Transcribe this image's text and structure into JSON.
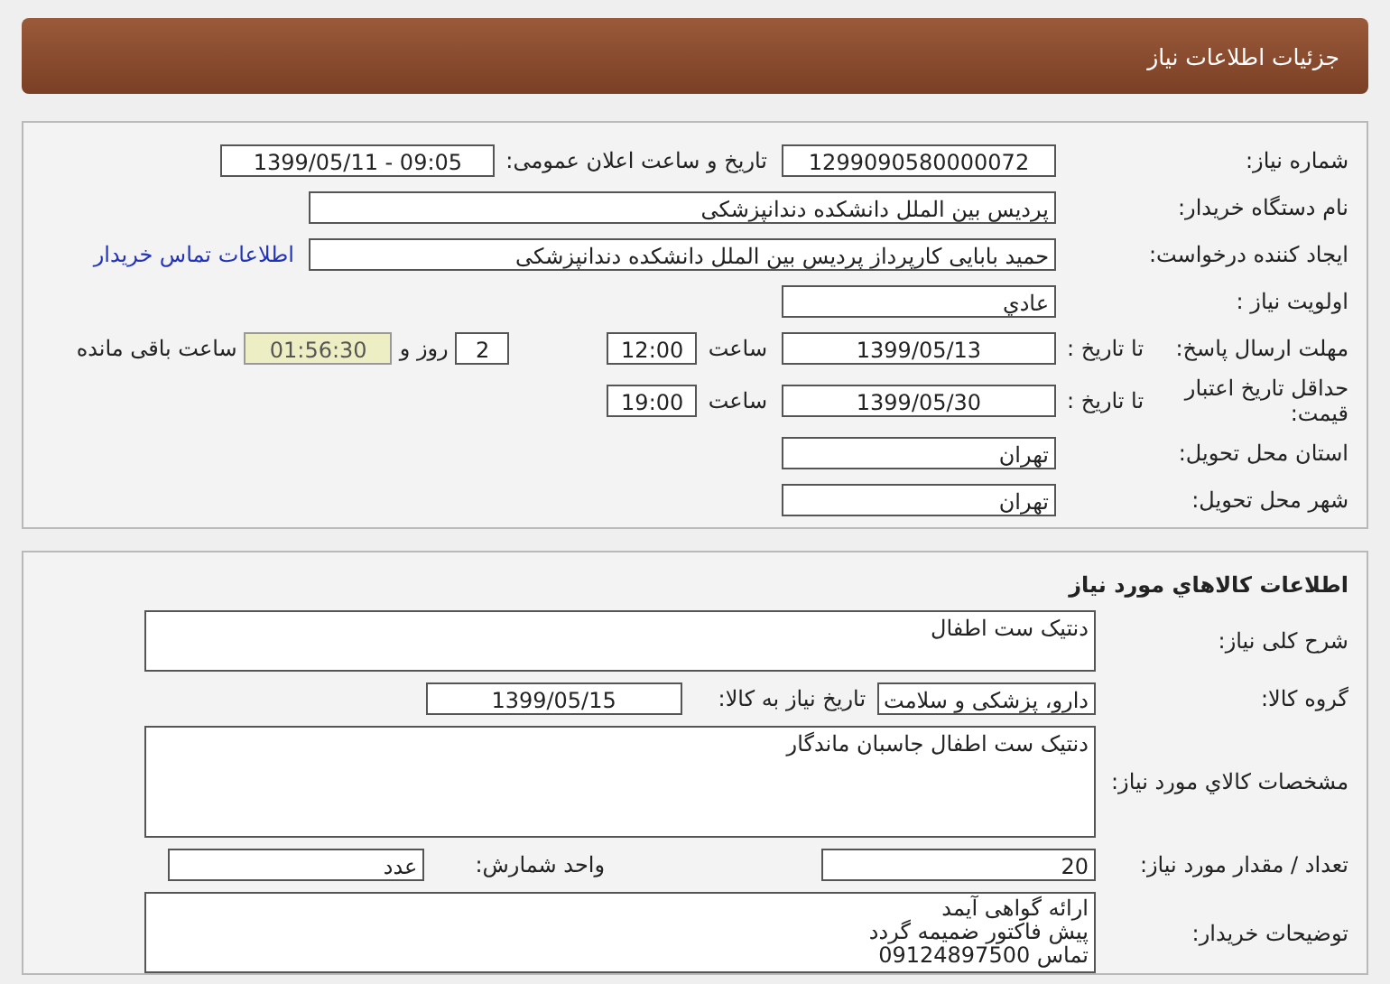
{
  "header": {
    "title": "جزئیات اطلاعات نیاز"
  },
  "tender": {
    "number_label": "شماره نیاز:",
    "number": "1299090580000072",
    "announce_label": "تاریخ و ساعت اعلان عمومی:",
    "announce": "1399/05/11 - 09:05",
    "buyer_label": "نام دستگاه خریدار:",
    "buyer": "پردیس بین الملل دانشکده دندانپزشکی",
    "creator_label": "ایجاد کننده درخواست:",
    "creator": "حمید بابایی کارپرداز پردیس بین الملل دانشکده دندانپزشکی",
    "contact_link": "اطلاعات تماس خریدار",
    "priority_label": "اولویت نیاز :",
    "priority": "عادي",
    "deadline_label": "مهلت ارسال پاسخ:",
    "deadline_to": "تا تاریخ :",
    "deadline_date": "1399/05/13",
    "deadline_time_label": "ساعت",
    "deadline_time": "12:00",
    "days": "2",
    "days_label": "روز و",
    "remaining": "01:56:30",
    "remaining_label": "ساعت باقی مانده",
    "validity_label": "حداقل تاریخ اعتبار قیمت:",
    "validity_to": "تا تاریخ :",
    "validity_date": "1399/05/30",
    "validity_time_label": "ساعت",
    "validity_time": "19:00",
    "province_label": "استان محل تحویل:",
    "province": "تهران",
    "city_label": "شهر محل تحویل:",
    "city": "تهران"
  },
  "goods": {
    "title": "اطلاعات کالاهاي مورد نياز",
    "summary_label": "شرح کلی نیاز:",
    "summary": "دنتیک ست اطفال",
    "group_label": "گروه کالا:",
    "group": "دارو، پزشکی و سلامت",
    "need_date_label": "تاریخ نیاز به کالا:",
    "need_date": "1399/05/15",
    "specs_label": "مشخصات کالاي مورد نياز:",
    "specs": "دنتیک ست اطفال جاسبان ماندگار",
    "quantity_label": "تعداد / مقدار مورد نیاز:",
    "quantity": "20",
    "unit_label": "واحد شمارش:",
    "unit": "عدد",
    "notes_label": "توضیحات خریدار:",
    "notes": [
      "ارائه گواهی آیمد",
      "پیش فاکتور ضمیمه گردد",
      "تماس 09124897500"
    ]
  }
}
